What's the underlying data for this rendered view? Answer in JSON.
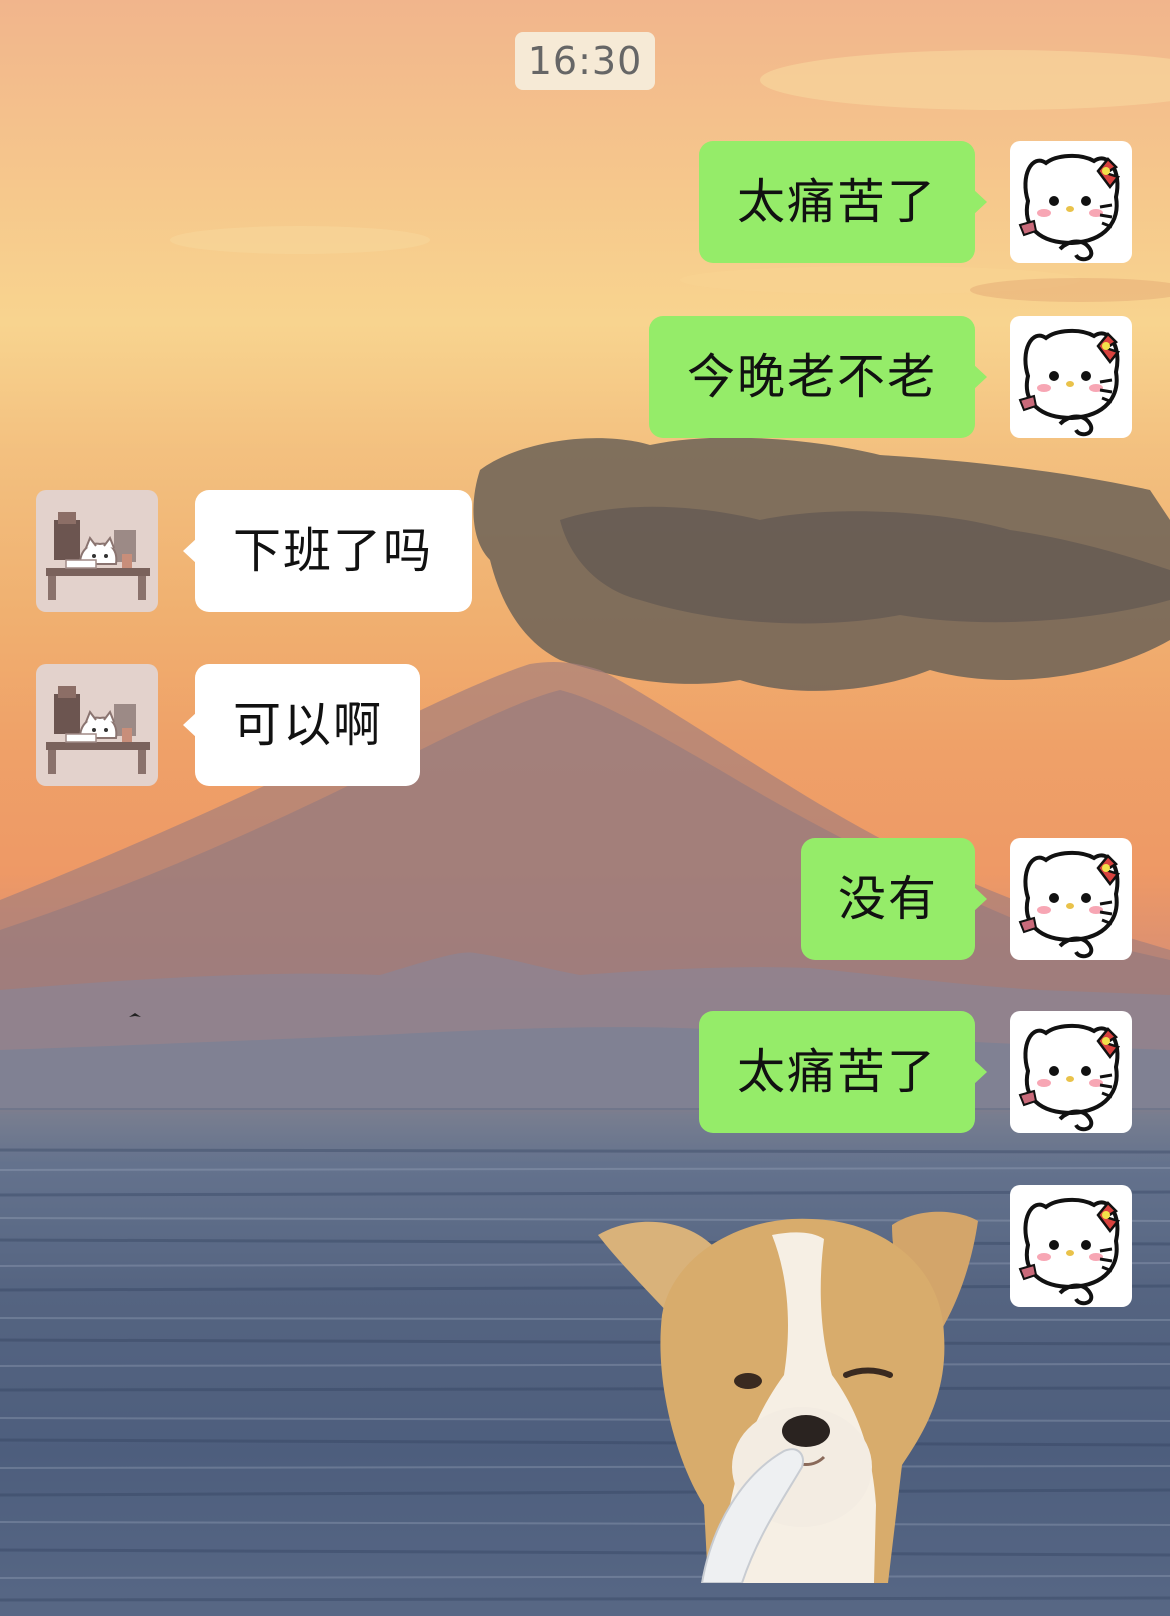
{
  "chat": {
    "timestamp": "16:30",
    "messages": [
      {
        "side": "right",
        "text": "太痛苦了"
      },
      {
        "side": "right",
        "text": "今晚老不老"
      },
      {
        "side": "left",
        "text": "下班了吗"
      },
      {
        "side": "left",
        "text": "可以啊"
      },
      {
        "side": "right",
        "text": "没有"
      },
      {
        "side": "right",
        "text": "太痛苦了"
      },
      {
        "side": "right",
        "type": "sticker",
        "sticker": "winking-dog-sticker"
      }
    ]
  },
  "avatars": {
    "self": "hello-kitty-avatar",
    "contact": "cat-at-desk-avatar"
  },
  "colors": {
    "sent_bubble": "#95ec69",
    "received_bubble": "#ffffff",
    "timestamp_bg": "#f6eedc",
    "text": "#111111"
  }
}
